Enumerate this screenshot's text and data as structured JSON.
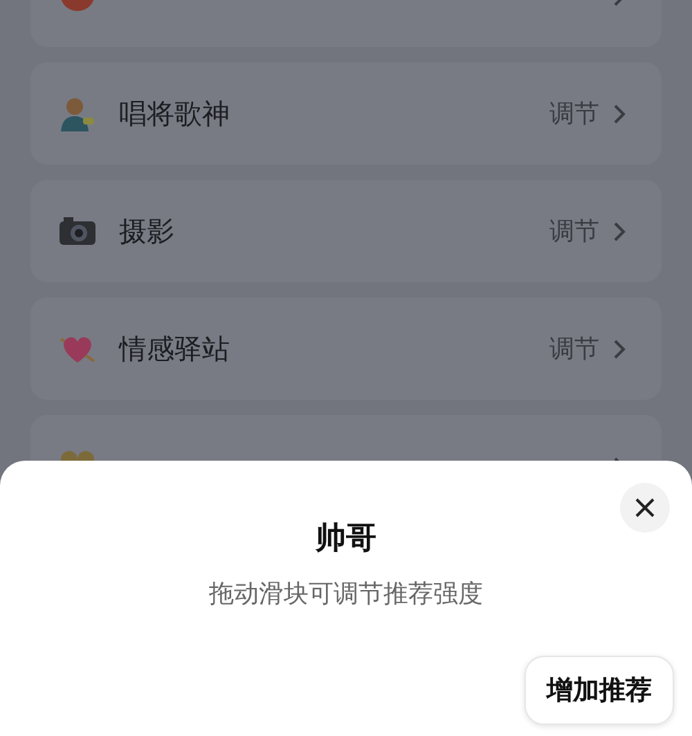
{
  "list": {
    "items": [
      {
        "kind": "bowl"
      },
      {
        "kind": "singer",
        "label": "唱将歌神",
        "action": "调节"
      },
      {
        "kind": "camera",
        "label": "摄影",
        "action": "调节"
      },
      {
        "kind": "heart",
        "label": "情感驿站",
        "action": "调节"
      },
      {
        "kind": "family"
      }
    ]
  },
  "sheet": {
    "title": "帅哥",
    "subtitle": "拖动滑块可调节推荐强度",
    "tooltip": "增加推荐"
  }
}
